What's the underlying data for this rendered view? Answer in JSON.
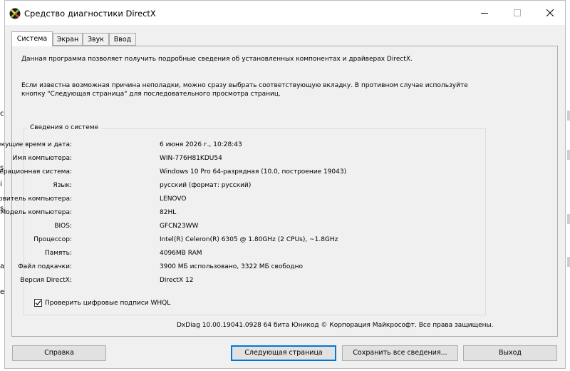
{
  "window": {
    "title": "Средство диагностики DirectX",
    "icon": "directx-icon",
    "controls": [
      "minimize-icon",
      "maximize-icon",
      "close-icon"
    ]
  },
  "tabs": [
    {
      "label": "Система",
      "active": true
    },
    {
      "label": "Экран"
    },
    {
      "label": "Звук"
    },
    {
      "label": "Ввод"
    }
  ],
  "intro": {
    "line1": "Данная программа позволяет получить подробные сведения об установленных компонентах и драйверах DirectX.",
    "line2": "Если известна возможная причина неполадки, можно сразу выбрать соответствующую вкладку. В противном случае используйте",
    "line3": "кнопку \"Следующая страница\" для последовательного просмотра страниц."
  },
  "system_info": {
    "group_title": "Сведения о системе",
    "rows": [
      {
        "label": "Текущие время и дата:",
        "value": "6 июня 2026 г., 10:28:43"
      },
      {
        "label": "Имя компьютера:",
        "value": "WIN-776H81KDU54"
      },
      {
        "label": "Операционная система:",
        "value": "Windows 10 Pro 64-разрядная (10.0, построение 19043)"
      },
      {
        "label": "Язык:",
        "value": "русский (формат: русский)"
      },
      {
        "label": "Изготовитель компьютера:",
        "value": "LENOVO"
      },
      {
        "label": "Модель компьютера:",
        "value": "82HL"
      },
      {
        "label": "BIOS:",
        "value": "GFCN23WW"
      },
      {
        "label": "Процессор:",
        "value": "Intel(R) Celeron(R) 6305 @ 1.80GHz (2 CPUs), ~1.8GHz"
      },
      {
        "label": "Память:",
        "value": "4096MB RAM"
      },
      {
        "label": "Файл подкачки:",
        "value": "3900 МБ использовано, 3322 МБ свободно"
      },
      {
        "label": "Версия DirectX:",
        "value": "DirectX 12"
      }
    ]
  },
  "whql_checkbox": {
    "label": "Проверить цифровые подписи WHQL",
    "checked": true
  },
  "footer": "DxDiag 10.00.19041.0928 64 бита Юникод © Корпорация Майкрософт. Все права защищены.",
  "buttons": {
    "help": "Справка",
    "next_page": "Следующая страница",
    "save_all": "Сохранить все сведения...",
    "exit": "Выход"
  },
  "background_edge_chars": [
    "с",
    "s",
    "i",
    "s",
    "а",
    "е"
  ],
  "colors": {
    "accent": "#0078d7",
    "panel": "#f0f0f0",
    "titlebar": "#ffffff"
  }
}
